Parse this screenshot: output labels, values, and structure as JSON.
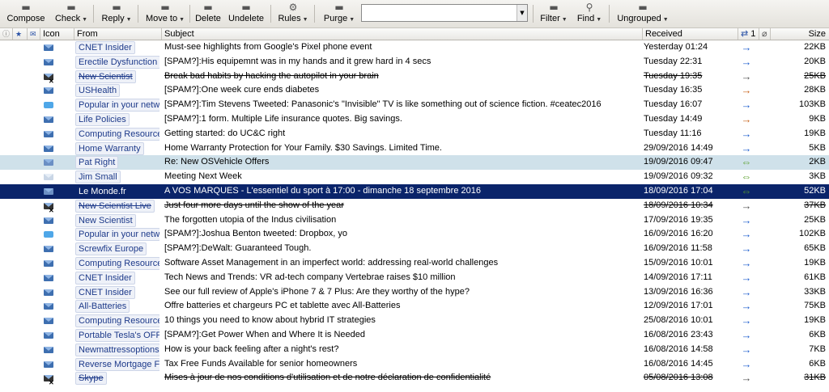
{
  "toolbar": {
    "compose": "Compose",
    "check": "Check",
    "reply": "Reply",
    "move_to": "Move to",
    "delete": "Delete",
    "undelete": "Undelete",
    "rules": "Rules",
    "purge": "Purge",
    "search_value": "",
    "filter": "Filter",
    "find": "Find",
    "ungrouped": "Ungrouped"
  },
  "columns": {
    "icon": "Icon",
    "from": "From",
    "subject": "Subject",
    "received": "Received",
    "one": "1",
    "size": "Size"
  },
  "colors": {
    "arrow_blue": "#1f5fcf",
    "arrow_orange": "#c8641c",
    "arrow_green": "#5aa02c",
    "arrow_gray": "#555555",
    "selection": "#0a246a",
    "highlight": "#cfe1ea"
  },
  "messages": [
    {
      "from": "CNET Insider",
      "subject": "Must-see highlights from Google's Pixel phone event",
      "received": "Yesterday 01:24",
      "size": "22KB",
      "icon": "envelope-icon",
      "arrow": "→",
      "arrow_color": "blue",
      "state": ""
    },
    {
      "from": "Erectile Dysfunction",
      "subject": "[SPAM?]:His equipemnt was in my hands and it grew hard in 4 secs",
      "received": "Tuesday 22:31",
      "size": "20KB",
      "icon": "envelope-icon",
      "arrow": "→",
      "arrow_color": "blue",
      "state": ""
    },
    {
      "from": "New Scientist",
      "subject": "Break bad habits by hacking the autopilot in your brain",
      "received": "Tuesday 19:35",
      "size": "25KB",
      "icon": "deleted-envelope-icon",
      "arrow": "→",
      "arrow_color": "gray",
      "state": "del"
    },
    {
      "from": "USHealth",
      "subject": "[SPAM?]:One week cure ends diabetes",
      "received": "Tuesday 16:35",
      "size": "28KB",
      "icon": "envelope-icon",
      "arrow": "→",
      "arrow_color": "orange",
      "state": ""
    },
    {
      "from": "Popular in your network",
      "subject": "[SPAM?]:Tim Stevens Tweeted: Panasonic's \"Invisible\" TV is like something out of science fiction. #ceatec2016",
      "received": "Tuesday 16:07",
      "size": "103KB",
      "icon": "twitter-icon",
      "arrow": "→",
      "arrow_color": "blue",
      "state": ""
    },
    {
      "from": "Life Policies",
      "subject": "[SPAM?]:1 form. Multiple Life insurance quotes. Big savings.",
      "received": "Tuesday 14:49",
      "size": "9KB",
      "icon": "envelope-icon",
      "arrow": "→",
      "arrow_color": "orange",
      "state": ""
    },
    {
      "from": "Computing Resources",
      "subject": "Getting started: do UC&C right",
      "received": "Tuesday 11:16",
      "size": "19KB",
      "icon": "envelope-icon",
      "arrow": "→",
      "arrow_color": "blue",
      "state": ""
    },
    {
      "from": "Home Warranty",
      "subject": "Home Warranty Protection for Your Family. $30 Savings. Limited Time.",
      "received": "29/09/2016 14:49",
      "size": "5KB",
      "icon": "envelope-icon",
      "arrow": "→",
      "arrow_color": "blue",
      "state": ""
    },
    {
      "from": "Pat Right",
      "subject": "Re: New OSVehicle Offers",
      "received": "19/09/2016 09:47",
      "size": "2KB",
      "icon": "open-envelope-icon",
      "arrow": "⇔",
      "arrow_color": "green",
      "state": "light"
    },
    {
      "from": "Jim Small",
      "subject": "Meeting Next Week",
      "received": "19/09/2016 09:32",
      "size": "3KB",
      "icon": "read-envelope-icon",
      "arrow": "⇔",
      "arrow_color": "green",
      "state": ""
    },
    {
      "from": "Le Monde.fr",
      "subject": "A VOS MARQUES - L'essentiel du sport à 17:00 - dimanche 18 septembre 2016",
      "received": "18/09/2016 17:04",
      "size": "52KB",
      "icon": "envelope-icon",
      "arrow": "⇔",
      "arrow_color": "green",
      "state": "sel"
    },
    {
      "from": "New Scientist Live",
      "subject": "Just four more days until the show of the year",
      "received": "18/09/2016 10:34",
      "size": "37KB",
      "icon": "deleted-envelope-icon",
      "arrow": "→",
      "arrow_color": "gray",
      "state": "del"
    },
    {
      "from": "New Scientist",
      "subject": "The forgotten utopia of the Indus civilisation",
      "received": "17/09/2016 19:35",
      "size": "25KB",
      "icon": "envelope-icon",
      "arrow": "→",
      "arrow_color": "blue",
      "state": ""
    },
    {
      "from": "Popular in your network",
      "subject": "[SPAM?]:Joshua Benton tweeted: Dropbox, yo",
      "received": "16/09/2016 16:20",
      "size": "102KB",
      "icon": "twitter-icon",
      "arrow": "→",
      "arrow_color": "blue",
      "state": ""
    },
    {
      "from": "Screwfix Europe",
      "subject": "[SPAM?]:DeWalt: Guaranteed Tough.",
      "received": "16/09/2016 11:58",
      "size": "65KB",
      "icon": "envelope-icon",
      "arrow": "→",
      "arrow_color": "blue",
      "state": ""
    },
    {
      "from": "Computing Resources",
      "subject": "Software Asset Management in an imperfect world: addressing   real-world challenges",
      "received": "15/09/2016 10:01",
      "size": "19KB",
      "icon": "envelope-icon",
      "arrow": "→",
      "arrow_color": "blue",
      "state": ""
    },
    {
      "from": "CNET Insider",
      "subject": "Tech News and Trends: VR ad-tech company Vertebrae raises $10 million",
      "received": "14/09/2016 17:11",
      "size": "61KB",
      "icon": "envelope-icon",
      "arrow": "→",
      "arrow_color": "blue",
      "state": ""
    },
    {
      "from": "CNET Insider",
      "subject": "See our full review of Apple's iPhone 7 & 7 Plus: Are they worthy of the hype?",
      "received": "13/09/2016 16:36",
      "size": "33KB",
      "icon": "envelope-icon",
      "arrow": "→",
      "arrow_color": "blue",
      "state": ""
    },
    {
      "from": "All-Batteries",
      "subject": "Offre batteries et chargeurs PC et tablette avec All-Batteries",
      "received": "12/09/2016 17:01",
      "size": "75KB",
      "icon": "envelope-icon",
      "arrow": "→",
      "arrow_color": "blue",
      "state": ""
    },
    {
      "from": "Computing Resources",
      "subject": "10 things you need to know about hybrid IT strategies",
      "received": "25/08/2016 10:01",
      "size": "19KB",
      "icon": "envelope-icon",
      "arrow": "→",
      "arrow_color": "blue",
      "state": ""
    },
    {
      "from": "Portable Tesla's OFF-Grid",
      "subject": "[SPAM?]:Get Power When and Where It is Needed",
      "received": "16/08/2016 23:43",
      "size": "6KB",
      "icon": "envelope-icon",
      "arrow": "→",
      "arrow_color": "blue",
      "state": ""
    },
    {
      "from": "Newmattressoptions.com",
      "subject": "How is your back feeling after a night's rest?",
      "received": "16/08/2016 14:58",
      "size": "7KB",
      "icon": "envelope-icon",
      "arrow": "→",
      "arrow_color": "blue",
      "state": ""
    },
    {
      "from": "Reverse Mortgage Facts",
      "subject": "Tax Free Funds Available for senior homeowners",
      "received": "16/08/2016 14:45",
      "size": "6KB",
      "icon": "envelope-icon",
      "arrow": "→",
      "arrow_color": "blue",
      "state": ""
    },
    {
      "from": "Skype",
      "subject": "Mises à jour de nos conditions d'utilisation et de notre déclaration de confidentialité",
      "received": "05/08/2016 13:08",
      "size": "31KB",
      "icon": "deleted-envelope-icon",
      "arrow": "→",
      "arrow_color": "gray",
      "state": "del"
    }
  ]
}
